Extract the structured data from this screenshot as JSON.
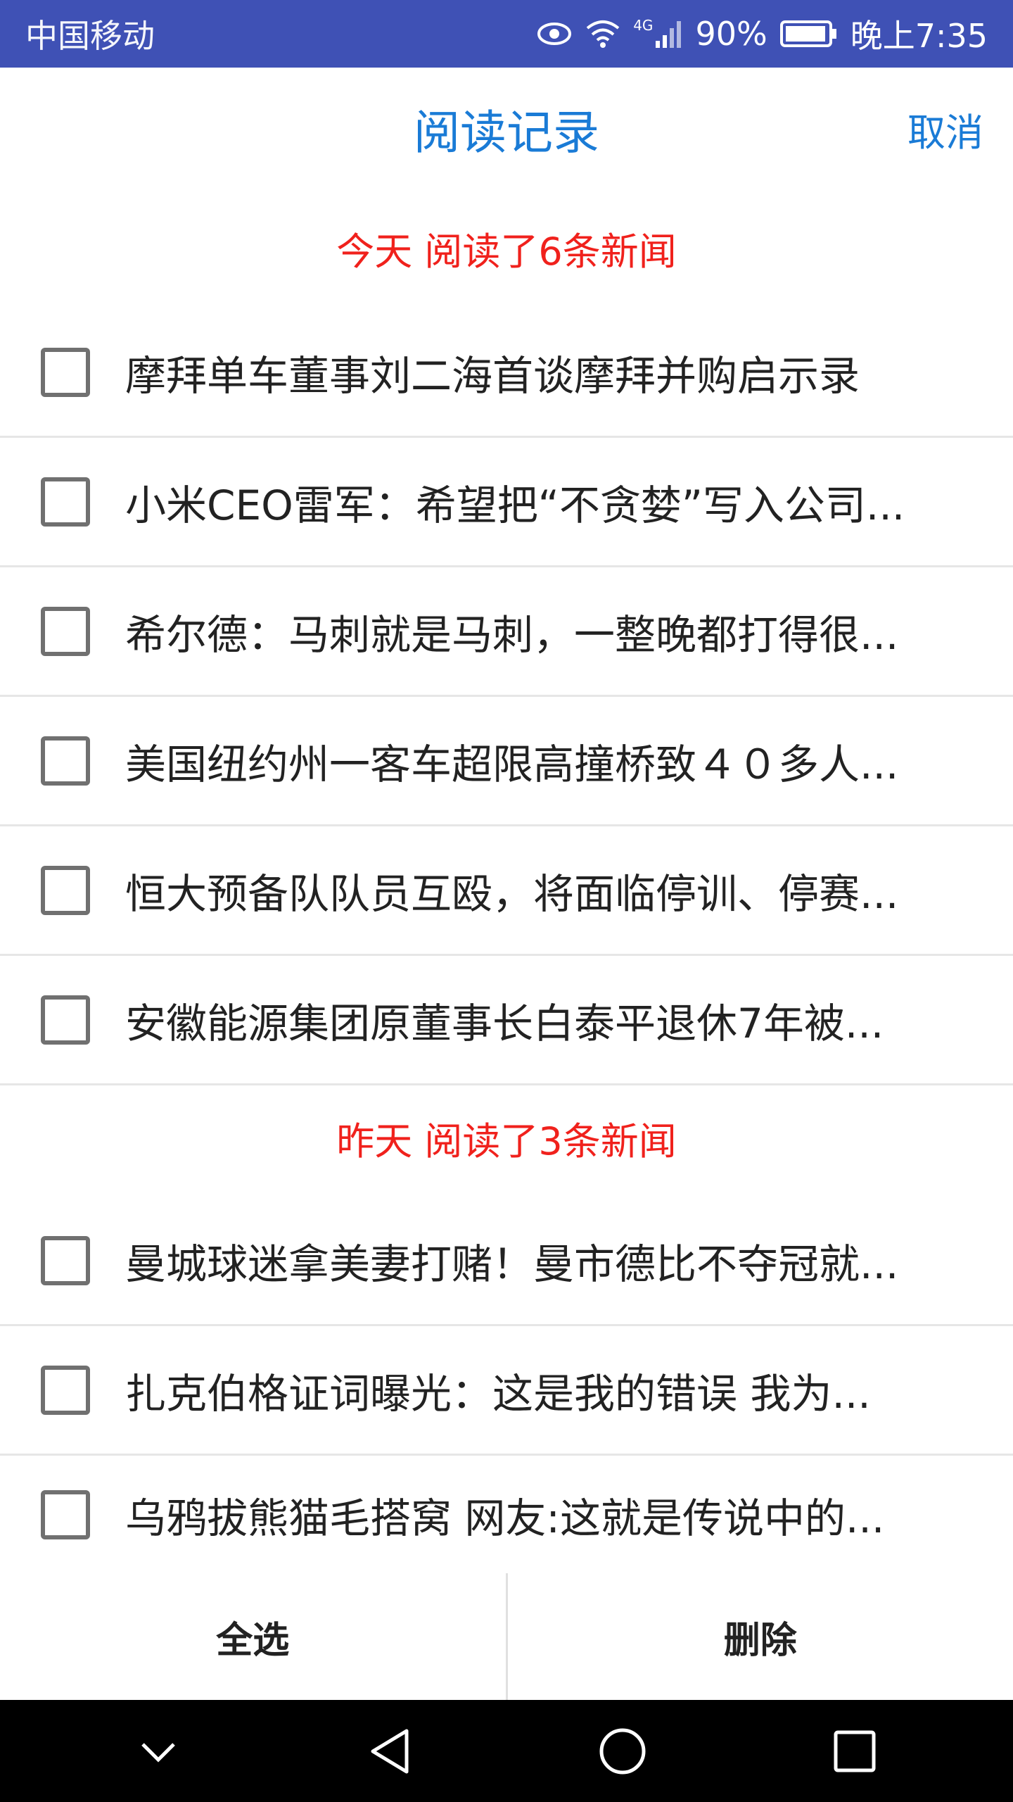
{
  "status_bar": {
    "carrier": "中国移动",
    "network": "4G",
    "battery": "90%",
    "time": "晚上7:35",
    "icons": [
      "eye-icon",
      "wifi-icon",
      "signal-icon",
      "battery-icon"
    ]
  },
  "header": {
    "title": "阅读记录",
    "cancel_label": "取消"
  },
  "sections": [
    {
      "header": "今天 阅读了6条新闻",
      "items": [
        "摩拜单车董事刘二海首谈摩拜并购启示录",
        "小米CEO雷军：希望把“不贪婪”写入公司...",
        "希尔德：马刺就是马刺，一整晚都打得很...",
        "美国纽约州一客车超限高撞桥致４０多人...",
        "恒大预备队队员互殴，将面临停训、停赛...",
        "安徽能源集团原董事长白泰平退休7年被..."
      ]
    },
    {
      "header": "昨天 阅读了3条新闻",
      "items": [
        "曼城球迷拿美妻打赌！曼市德比不夺冠就...",
        "扎克伯格证词曝光：这是我的错误 我为...",
        "乌鸦拔熊猫毛搭窝 网友:这就是传说中的..."
      ]
    }
  ],
  "bottom_bar": {
    "select_all_label": "全选",
    "delete_label": "删除"
  },
  "nav_bar": {
    "icons": [
      "chevron-down-icon",
      "back-icon",
      "home-icon",
      "recents-icon"
    ]
  },
  "colors": {
    "status_bar": "#3f51b5",
    "accent_blue": "#1a7bd6",
    "section_red": "#f0211c"
  }
}
